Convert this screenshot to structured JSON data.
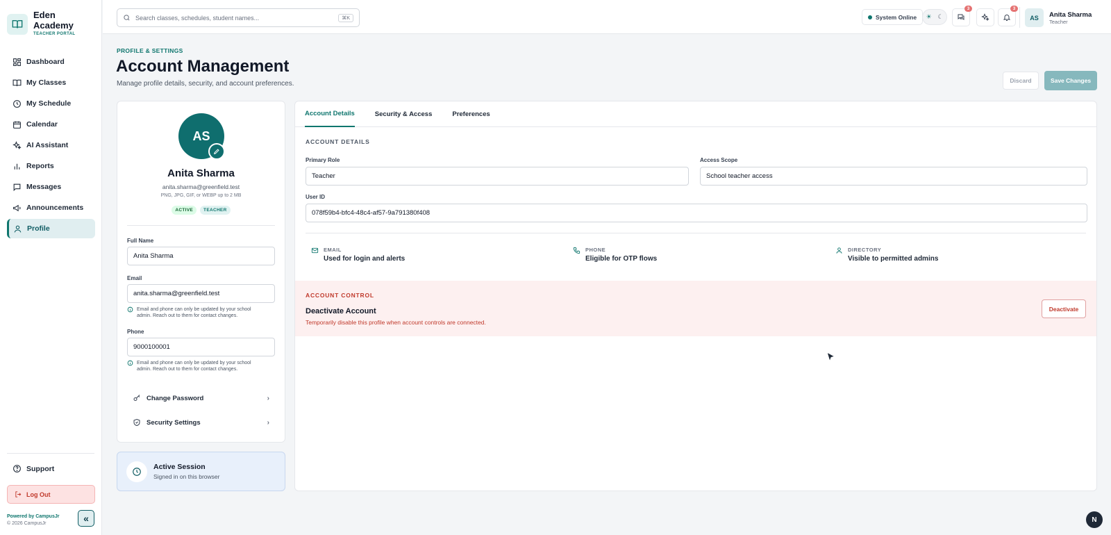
{
  "brand": {
    "name_line1": "Eden",
    "name_line2": "Academy",
    "subtitle": "TEACHER PORTAL",
    "accent": "#0f766e"
  },
  "sidebar": {
    "items": [
      {
        "label": "Dashboard",
        "icon": "grid-icon"
      },
      {
        "label": "My Classes",
        "icon": "book-icon"
      },
      {
        "label": "My Schedule",
        "icon": "clock-icon"
      },
      {
        "label": "Calendar",
        "icon": "calendar-icon"
      },
      {
        "label": "AI Assistant",
        "icon": "sparkle-icon"
      },
      {
        "label": "Reports",
        "icon": "bar-chart-icon"
      },
      {
        "label": "Messages",
        "icon": "message-icon"
      },
      {
        "label": "Announcements",
        "icon": "megaphone-icon"
      },
      {
        "label": "Profile",
        "icon": "user-icon",
        "active": true
      }
    ],
    "support_label": "Support",
    "logout_label": "Log Out",
    "powered_by": "Powered by CampusJr",
    "copyright": "© 2026 CampusJr",
    "collapse_glyph": "«"
  },
  "header": {
    "search_placeholder": "Search classes, schedules, student names...",
    "search_shortcut": "⌘K",
    "status_text": "System Online",
    "status_color": "#0f766e",
    "messages_badge": "3",
    "notifications_badge": "3",
    "user_initials": "AS",
    "user_name": "Anita Sharma",
    "user_role": "Teacher"
  },
  "page": {
    "eyebrow": "PROFILE & SETTINGS",
    "title": "Account Management",
    "subtitle": "Manage profile details, security, and account preferences.",
    "discard_label": "Discard",
    "save_label": "Save Changes"
  },
  "profile": {
    "initials": "AS",
    "name": "Anita Sharma",
    "email": "anita.sharma@greenfield.test",
    "upload_hint": "PNG, JPG, GIF, or WEBP up to 2 MB",
    "badges": [
      "ACTIVE",
      "TEACHER"
    ],
    "full_name_label": "Full Name",
    "full_name_value": "Anita Sharma",
    "email_label": "Email",
    "email_value": "anita.sharma@greenfield.test",
    "email_help": "Email and phone can only be updated by your school admin. Reach out to them for contact changes.",
    "phone_label": "Phone",
    "phone_value": "9000100001",
    "phone_help": "Email and phone can only be updated by your school admin. Reach out to them for contact changes.",
    "change_password_label": "Change Password",
    "security_settings_label": "Security Settings"
  },
  "session": {
    "title": "Active Session",
    "subtitle": "Signed in on this browser"
  },
  "tabs": [
    "Account Details",
    "Security & Access",
    "Preferences"
  ],
  "account": {
    "section_title": "ACCOUNT DETAILS",
    "primary_role_label": "Primary Role",
    "primary_role_value": "Teacher",
    "access_scope_label": "Access Scope",
    "access_scope_value": "School teacher access",
    "user_id_label": "User ID",
    "user_id_value": "078f59b4-bfc4-48c4-af57-9a791380f408",
    "info": [
      {
        "key": "EMAIL",
        "value": "Used for login and alerts",
        "icon": "mail-icon"
      },
      {
        "key": "PHONE",
        "value": "Eligible for OTP flows",
        "icon": "phone-icon"
      },
      {
        "key": "DIRECTORY",
        "value": "Visible to permitted admins",
        "icon": "user-icon"
      }
    ]
  },
  "control": {
    "section_title": "ACCOUNT CONTROL",
    "title": "Deactivate Account",
    "subtitle": "Temporarily disable this profile when account controls are connected.",
    "button_label": "Deactivate",
    "danger_color": "#c0392b"
  },
  "corner_badge": "N"
}
